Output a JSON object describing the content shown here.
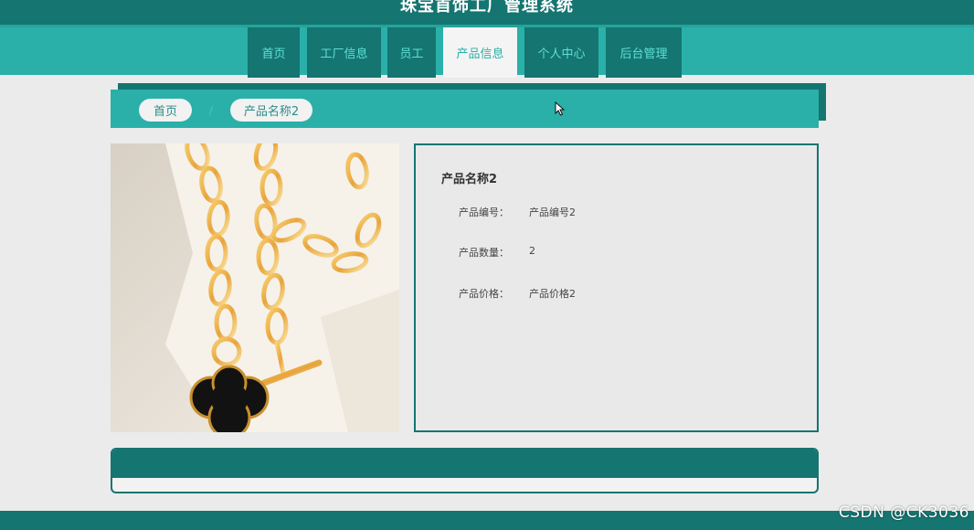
{
  "header": {
    "title": "珠宝首饰工厂管理系统"
  },
  "nav": {
    "items": [
      {
        "label": "首页"
      },
      {
        "label": "工厂信息"
      },
      {
        "label": "员工"
      },
      {
        "label": "产品信息",
        "active": true
      },
      {
        "label": "个人中心"
      },
      {
        "label": "后台管理"
      }
    ]
  },
  "breadcrumb": {
    "home": "首页",
    "separator": "/",
    "current": "产品名称2"
  },
  "product": {
    "image_icon": "jewelry-necklace-photo",
    "name": "产品名称2",
    "fields": [
      {
        "label": "产品编号：",
        "value": "产品编号2"
      },
      {
        "label": "产品数量：",
        "value": "2"
      },
      {
        "label": "产品价格：",
        "value": "产品价格2"
      }
    ]
  },
  "watermark": "CSDN @CK3036",
  "colors": {
    "primary_dark": "#157571",
    "primary": "#2ab0a9",
    "background": "#ebebeb"
  }
}
